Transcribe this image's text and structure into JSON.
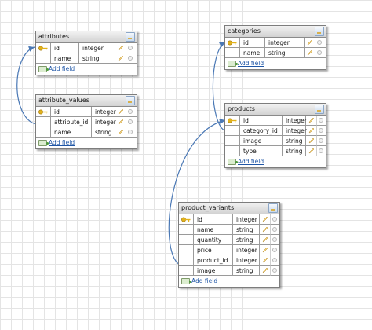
{
  "tables": {
    "attributes": {
      "title": "attributes",
      "add_field": "Add field",
      "fields": [
        {
          "name": "id",
          "type": "integer",
          "key": true
        },
        {
          "name": "name",
          "type": "string",
          "key": false
        }
      ]
    },
    "attribute_values": {
      "title": "attribute_values",
      "add_field": "Add field",
      "fields": [
        {
          "name": "id",
          "type": "integer",
          "key": true
        },
        {
          "name": "attribute_id",
          "type": "integer",
          "key": false
        },
        {
          "name": "name",
          "type": "string",
          "key": false
        }
      ]
    },
    "categories": {
      "title": "categories",
      "add_field": "Add field",
      "fields": [
        {
          "name": "id",
          "type": "integer",
          "key": true
        },
        {
          "name": "name",
          "type": "string",
          "key": false
        }
      ]
    },
    "products": {
      "title": "products",
      "add_field": "Add field",
      "fields": [
        {
          "name": "id",
          "type": "integer",
          "key": true
        },
        {
          "name": "category_id",
          "type": "integer",
          "key": false
        },
        {
          "name": "image",
          "type": "string",
          "key": false
        },
        {
          "name": "type",
          "type": "string",
          "key": false
        }
      ]
    },
    "product_variants": {
      "title": "product_variants",
      "add_field": "Add field",
      "fields": [
        {
          "name": "id",
          "type": "integer",
          "key": true
        },
        {
          "name": "name",
          "type": "string",
          "key": false
        },
        {
          "name": "quantity",
          "type": "string",
          "key": false
        },
        {
          "name": "price",
          "type": "integer",
          "key": false
        },
        {
          "name": "product_id",
          "type": "integer",
          "key": false
        },
        {
          "name": "image",
          "type": "string",
          "key": false
        }
      ]
    }
  },
  "relations": [
    {
      "from": "attribute_values.attribute_id",
      "to": "attributes.id"
    },
    {
      "from": "products.category_id",
      "to": "categories.id"
    },
    {
      "from": "product_variants.product_id",
      "to": "products.id"
    }
  ],
  "colors": {
    "link_line": "#4a78b5",
    "add_link": "#1f56a6",
    "key_icon": "#e2b21c"
  }
}
